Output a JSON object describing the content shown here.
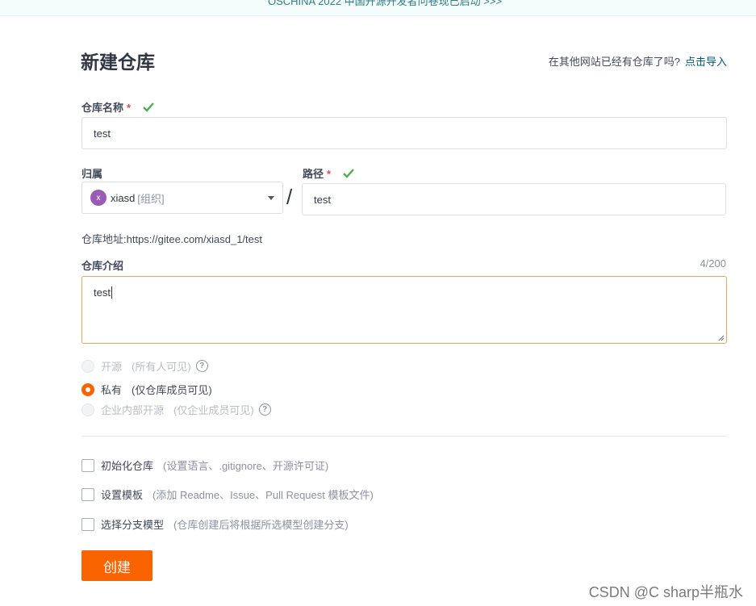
{
  "banner": {
    "text": "OSCHINA 2022 中国开源开发者问卷现已启动 >>>"
  },
  "page": {
    "title": "新建仓库"
  },
  "import": {
    "hint": "在其他网站已经有仓库了吗?",
    "link": "点击导入"
  },
  "repo_name": {
    "label": "仓库名称",
    "required_mark": "*",
    "value": "test"
  },
  "owner": {
    "label": "归属",
    "avatar_letter": "x",
    "name": "xiasd",
    "tag": "[组织]"
  },
  "separator": "/",
  "path": {
    "label": "路径",
    "required_mark": "*",
    "value": "test"
  },
  "repo_url": {
    "label": "仓库地址:",
    "value": "https://gitee.com/xiasd_1/test"
  },
  "description": {
    "label": "仓库介绍",
    "count": "4/200",
    "value": "test"
  },
  "visibility": {
    "options": [
      {
        "label": "开源",
        "desc": "(所有人可见)",
        "state": "disabled",
        "has_help": true
      },
      {
        "label": "私有",
        "desc": "(仅仓库成员可见)",
        "state": "checked",
        "has_help": false
      },
      {
        "label": "企业内部开源",
        "desc": "(仅企业成员可见)",
        "state": "disabled",
        "has_help": true
      }
    ],
    "help_glyph": "?"
  },
  "options": [
    {
      "label": "初始化仓库",
      "desc": "(设置语言、.gitignore、开源许可证)"
    },
    {
      "label": "设置模板",
      "desc": "(添加 Readme、Issue、Pull Request 模板文件)"
    },
    {
      "label": "选择分支模型",
      "desc": "(仓库创建后将根据所选模型创建分支)"
    }
  ],
  "create_button": {
    "label": "创建"
  },
  "watermark": "CSDN @C sharp半瓶水",
  "colors": {
    "accent": "#fa6400",
    "check_green": "#4caf50",
    "link": "#005980",
    "avatar": "#9a5bb5"
  },
  "icons": {
    "valid": "check-icon",
    "dropdown": "chevron-down-icon",
    "help": "question-circle-icon"
  }
}
